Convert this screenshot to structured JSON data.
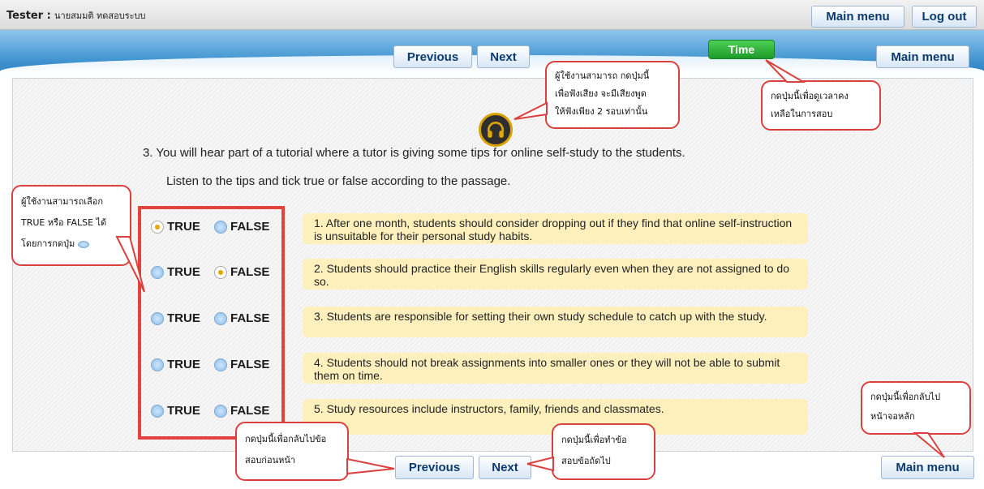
{
  "header": {
    "tester_label": "Tester :",
    "tester_name": "นายสมมติ ทดสอบระบบ",
    "main_menu_label": "Main menu",
    "logout_label": "Log out"
  },
  "nav": {
    "previous_label": "Previous",
    "next_label": "Next",
    "time_label": "Time",
    "main_menu_label": "Main menu"
  },
  "question": {
    "line1": "3.  You will hear part of a tutorial where a tutor is giving some tips for online self-study to the students.",
    "line2": "Listen to the tips and tick true or false according to the passage.",
    "true_label": "TRUE",
    "false_label": "FALSE",
    "items": [
      {
        "text": "1. After one month, students should consider dropping out if they find that online self-instruction is unsuitable for their personal study habits.",
        "selected": "TRUE"
      },
      {
        "text": "2. Students should practice their English skills regularly even when they are not assigned to do so.",
        "selected": "FALSE"
      },
      {
        "text": "3. Students are responsible for setting their own study schedule to catch up with the study.",
        "selected": ""
      },
      {
        "text": "4. Students should not break assignments into smaller ones or they will not be able to submit them on time.",
        "selected": ""
      },
      {
        "text": "5.   Study resources include instructors, family, friends and classmates.",
        "selected": ""
      }
    ]
  },
  "footer": {
    "previous_label": "Previous",
    "next_label": "Next",
    "main_menu_label": "Main menu"
  },
  "callouts": {
    "audio": [
      "ผู้ใช้งานสามารถ กดปุ่มนี้",
      "เพื่อฟังเสียง จะมีเสียงพูด",
      "ให้ฟังเพียง 2 รอบเท่านั้น"
    ],
    "time": [
      "กดปุ่มนี้เพื่อดูเวลาคง",
      "เหลือในการสอบ"
    ],
    "select": [
      "ผู้ใช้งานสามารถเลือก",
      "TRUE หรือ FALSE ได้",
      "โดยการกดปุ่ม"
    ],
    "previous": [
      "กดปุ่มนี้เพื่อกลับไปข้อ",
      "สอบก่อนหน้า"
    ],
    "next": [
      "กดปุ่มนี้เพื่อทำข้อ",
      "สอบข้อถัดไป"
    ],
    "main_menu": [
      "กดปุ่มนี้เพื่อกลับไป",
      "หน้าจอหลัก"
    ]
  },
  "colors": {
    "accent_blue": "#3f93d0",
    "time_green": "#1d9b2a",
    "callout_red": "#d9413e",
    "statement_bg": "#fdf0bd"
  }
}
